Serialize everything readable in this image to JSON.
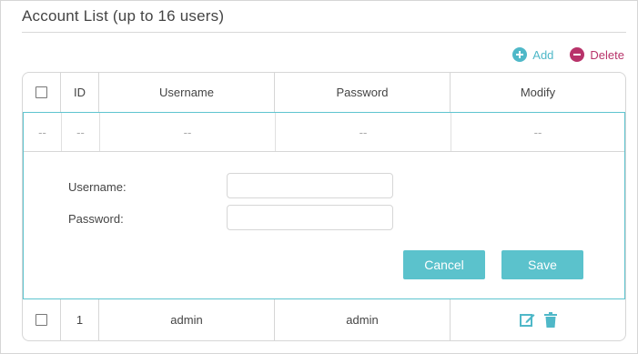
{
  "section": {
    "title": "Account List (up to 16 users)"
  },
  "toolbar": {
    "add_label": "Add",
    "delete_label": "Delete",
    "add_icon": "plus-circle-icon",
    "delete_icon": "minus-circle-icon",
    "add_color": "#4fb8c8",
    "delete_color": "#b8336a"
  },
  "table": {
    "headers": {
      "id": "ID",
      "username": "Username",
      "password": "Password",
      "modify": "Modify"
    },
    "new_row": {
      "checkbox": "--",
      "id": "--",
      "username": "--",
      "password": "--",
      "modify": "--"
    },
    "rows": [
      {
        "id": "1",
        "username": "admin",
        "password": "admin"
      }
    ]
  },
  "edit_form": {
    "username_label": "Username:",
    "password_label": "Password:",
    "username_value": "",
    "password_value": "",
    "cancel_label": "Cancel",
    "save_label": "Save"
  },
  "colors": {
    "accent": "#5bc2cc",
    "border": "#d6d6d6"
  }
}
